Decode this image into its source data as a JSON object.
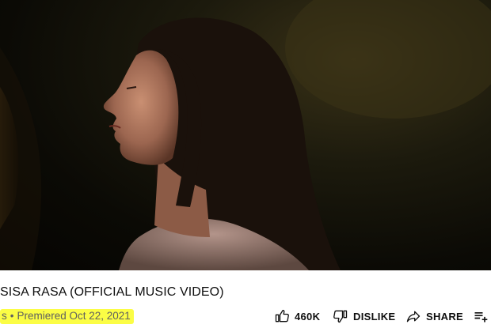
{
  "video": {
    "title": "SISA RASA (OFFICIAL MUSIC VIDEO)",
    "channel_fragment": "s",
    "separator": "•",
    "premiere_text": "Premiered Oct 22, 2021",
    "highlight_color": "#fbfd45"
  },
  "actions": {
    "like_count": "460K",
    "dislike_label": "DISLIKE",
    "share_label": "SHARE",
    "like_icon": "thumbs-up-icon",
    "dislike_icon": "thumbs-down-icon",
    "share_icon": "share-arrow-icon",
    "save_icon": "add-to-playlist-icon"
  }
}
